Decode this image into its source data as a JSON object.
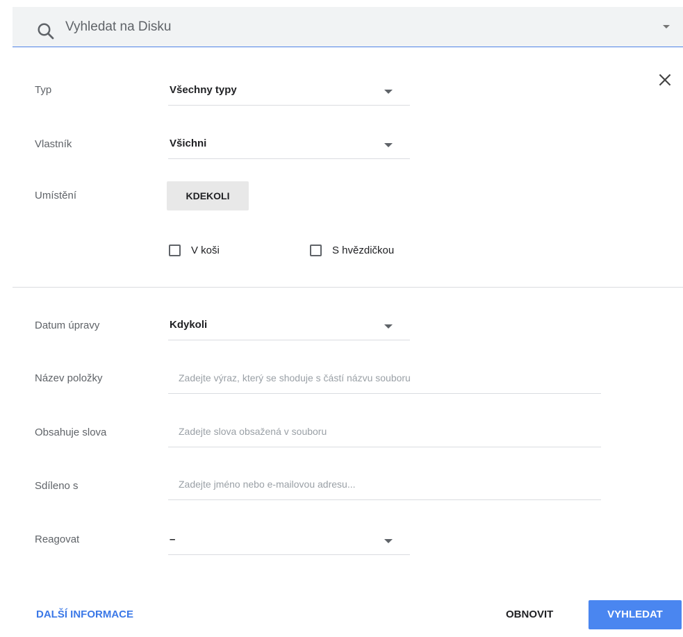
{
  "search": {
    "placeholder": "Vyhledat na Disku"
  },
  "filters": {
    "type": {
      "label": "Typ",
      "value": "Všechny typy"
    },
    "owner": {
      "label": "Vlastník",
      "value": "Všichni"
    },
    "location": {
      "label": "Umístění",
      "button_label": "KDEKOLI"
    },
    "in_trash": {
      "label": "V koši",
      "checked": false
    },
    "starred": {
      "label": "S hvězdičkou",
      "checked": false
    },
    "date_modified": {
      "label": "Datum úpravy",
      "value": "Kdykoli"
    },
    "item_name": {
      "label": "Název položky",
      "placeholder": "Zadejte výraz, který se shoduje s částí názvu souboru"
    },
    "has_words": {
      "label": "Obsahuje slova",
      "placeholder": "Zadejte slova obsažená v souboru"
    },
    "shared_with": {
      "label": "Sdíleno s",
      "placeholder": "Zadejte jméno nebo e-mailovou adresu..."
    },
    "follow_up": {
      "label": "Reagovat",
      "value": "–"
    }
  },
  "footer": {
    "more_info": "DALŠÍ INFORMACE",
    "reset": "OBNOVIT",
    "search": "VYHLEDAT"
  },
  "colors": {
    "accent": "#4a86f0",
    "link": "#3b78e7",
    "search_bg": "#f1f3f4"
  }
}
